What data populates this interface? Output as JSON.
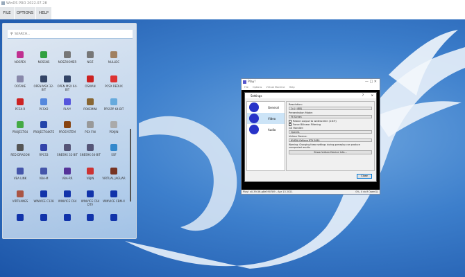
{
  "window": {
    "title": "WinDS PRO 2022.07.28"
  },
  "menu": [
    {
      "label": "FILE"
    },
    {
      "label": "OPTIONS"
    },
    {
      "label": "HELP"
    }
  ],
  "search": {
    "placeholder": "SEARCH..."
  },
  "apps": [
    {
      "label": "NOSPEX",
      "color": "#c03090"
    },
    {
      "label": "NOSSNS",
      "color": "#30a040"
    },
    {
      "label": "NOSZOOMER",
      "color": "#777777"
    },
    {
      "label": "NOZ",
      "color": "#777777"
    },
    {
      "label": "NULLDC",
      "color": "#a08060"
    },
    {
      "label": "OOTAKE",
      "color": "#8888aa"
    },
    {
      "label": "OPEN MSX 32-BIT",
      "color": "#334466"
    },
    {
      "label": "OPEN MSX 64-BIT",
      "color": "#334466"
    },
    {
      "label": "OSWAN",
      "color": "#cc2222"
    },
    {
      "label": "PCSX REDUX",
      "color": "#dd3333"
    },
    {
      "label": "PCSX-R",
      "color": "#cc2222"
    },
    {
      "label": "PCSX2",
      "color": "#5588dd"
    },
    {
      "label": "PLAY!",
      "color": "#5555dd"
    },
    {
      "label": "POKEMINI",
      "color": "#886633"
    },
    {
      "label": "PPSSPP 64-BIT",
      "color": "#66aadd"
    },
    {
      "label": "PROJECT64",
      "color": "#44aa44"
    },
    {
      "label": "PROJECT64K7E",
      "color": "#2244aa"
    },
    {
      "label": "PROSYSTEM",
      "color": "#884411"
    },
    {
      "label": "PSX FIN",
      "color": "#999999"
    },
    {
      "label": "PSXJIN",
      "color": "#aaaaaa"
    },
    {
      "label": "RED DRAGON",
      "color": "#555555"
    },
    {
      "label": "RPCS3",
      "color": "#3344aa"
    },
    {
      "label": "SNES9X 32-BIT",
      "color": "#555577"
    },
    {
      "label": "SNES9X 64-BIT",
      "color": "#555577"
    },
    {
      "label": "SSF",
      "color": "#3388cc"
    },
    {
      "label": "VBA LINK",
      "color": "#4455aa"
    },
    {
      "label": "VBA-M",
      "color": "#4455aa"
    },
    {
      "label": "VBA-RR",
      "color": "#553399"
    },
    {
      "label": "VBJIN",
      "color": "#cc3333"
    },
    {
      "label": "VIRTUAL JAGUAR",
      "color": "#773322"
    },
    {
      "label": "VIRTUANES",
      "color": "#aa5544"
    },
    {
      "label": "WINVICE C128",
      "color": "#1133aa"
    },
    {
      "label": "WINVICE C64",
      "color": "#1133aa"
    },
    {
      "label": "WINVICE C64 DTV",
      "color": "#1133aa"
    },
    {
      "label": "WINVICE CBM-II",
      "color": "#1133aa"
    },
    {
      "label": "",
      "color": "#1133aa"
    },
    {
      "label": "",
      "color": "#1133aa"
    },
    {
      "label": "",
      "color": "#1133aa"
    },
    {
      "label": "",
      "color": "#1133aa"
    },
    {
      "label": "",
      "color": "#1133aa"
    }
  ],
  "play": {
    "title": "Play!",
    "menu": [
      "File",
      "Options",
      "Virtual Machine",
      "Help"
    ],
    "status_left": "Play! v0.39-56-g8e390789 - Apr 13 2021",
    "status_right": "0%, 0 dc/f OpenGL",
    "settings": {
      "title": "Settings",
      "help": "?",
      "close": "✕",
      "nav": [
        {
          "label": "General"
        },
        {
          "label": "Video"
        },
        {
          "label": "Audio"
        }
      ],
      "resolution_label": "Resolution:",
      "resolution_value": "1x (~480)",
      "presentation_label": "Presentation Mode:",
      "presentation_value": "Fit Screen",
      "widescreen_label": "Resize output to widescreen (16:9)",
      "bilinear_label": "Force Bilinear Filtering",
      "gs_label": "GS Handler:",
      "gs_value": "OpenGL",
      "vulkan_label": "Vulkan Device:",
      "vulkan_value": "NVIDIA GeForce RTX 3080",
      "warning": "Warning: Changing these settings during gameplay can produce unexpected results.",
      "show_vulkan": "Show Vulkan Device Info...",
      "close_button": "Close"
    }
  }
}
